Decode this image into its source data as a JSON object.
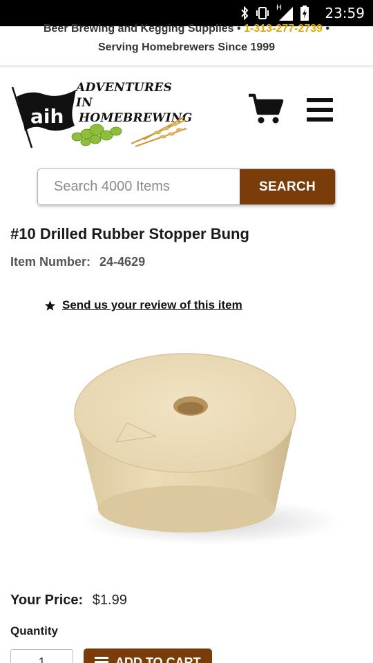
{
  "status_bar": {
    "time": "23:59",
    "network_label": "H"
  },
  "banner": {
    "line1_text": "Beer Brewing and Kegging Supplies",
    "separator": "•",
    "phone": "1-313-277-2739",
    "line2_text": "Serving Homebrewers Since 1999"
  },
  "logo": {
    "text_line1": "ADVENTURES IN",
    "text_line2": "HOMEBREWING",
    "flag_text": "aih"
  },
  "search": {
    "placeholder": "Search 4000 Items",
    "button_label": "SEARCH"
  },
  "product": {
    "title": "#10 Drilled Rubber Stopper Bung",
    "item_number_label": "Item Number:",
    "item_number": "24-4629",
    "review_link": "Send us your review of this item",
    "price_label": "Your Price:",
    "price": "$1.99",
    "quantity_label": "Quantity",
    "quantity_value": "1",
    "add_to_cart_label": "ADD TO CART"
  },
  "colors": {
    "accent_brown": "#7a3d0a",
    "phone_gold": "#e0a800"
  },
  "icons": [
    "bluetooth-icon",
    "vibrate-icon",
    "signal-icon",
    "battery-icon",
    "cart-icon",
    "hamburger-menu-icon",
    "star-icon"
  ]
}
